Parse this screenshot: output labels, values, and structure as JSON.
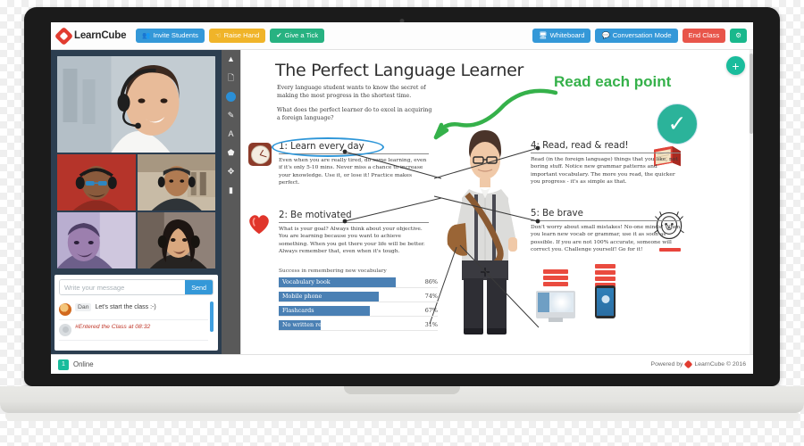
{
  "app": {
    "brand_name": "LearnCube",
    "brand_icon": "cube-logo-icon"
  },
  "toolbar_top": {
    "invite_students": "Invite Students",
    "invite_icon": "users-icon",
    "raise_hand": "Raise Hand",
    "raise_hand_icon": "hand-icon",
    "give_a_tick": "Give a Tick",
    "give_a_tick_icon": "check-icon",
    "whiteboard": "Whiteboard",
    "whiteboard_icon": "monitor-icon",
    "conversation_mode": "Conversation Mode",
    "conversation_icon": "speech-bubble-icon",
    "end_class": "End Class",
    "settings_icon": "gear-icon",
    "colors": {
      "blue": "#3498d8",
      "yellow": "#f0b429",
      "green": "#27b281",
      "red": "#e8554a",
      "teal": "#19b88c"
    }
  },
  "video_panel": {
    "main_tile": "teacher-video-tile",
    "tiles": [
      "student-video-tile-1",
      "student-video-tile-2",
      "student-video-tile-3",
      "student-video-tile-4"
    ]
  },
  "chat": {
    "input_placeholder": "Write your message",
    "input_value": "",
    "send_label": "Send",
    "messages": [
      {
        "author": "Dan",
        "text": "Let's start the class :-)",
        "system": false
      },
      {
        "author": "",
        "text": "#Entered the Class at 08:32",
        "system": true
      }
    ]
  },
  "tools": [
    {
      "name": "collapse-chevron-icon",
      "glyph": "▲"
    },
    {
      "name": "page-icon",
      "glyph": "❑"
    },
    {
      "name": "color-swatch-icon",
      "glyph": ""
    },
    {
      "name": "pencil-icon",
      "glyph": "✎"
    },
    {
      "name": "text-tool-icon",
      "glyph": "A"
    },
    {
      "name": "shape-tool-icon",
      "glyph": "⬟"
    },
    {
      "name": "move-tool-icon",
      "glyph": "✥"
    },
    {
      "name": "eraser-icon",
      "glyph": "▰"
    }
  ],
  "whiteboard": {
    "title": "The Perfect Language Learner",
    "intro_1": "Every language student wants to know the secret of making the most progress in the shortest time.",
    "intro_2": "What does the perfect learner do to excel in acquiring a foreign language?",
    "annotation": "Read each point",
    "annotation_color": "#35b14a",
    "add_button_icon": "plus-icon",
    "check_badge_icon": "check-circle-icon",
    "points": [
      {
        "heading": "1:  Learn every day",
        "body": "Even when you are really tired, do some learning, even if it's only 5-10 mins. Never miss a chance to increase your knowledge. Use it, or lose it! Practice makes perfect.",
        "icon": "clock-icon",
        "highlighted": true
      },
      {
        "heading": "2:  Be motivated",
        "body": "What is your goal? Always think about your objective. You are learning because you want to achieve something. When you get there your life will be better. Always remember that, even when it's tough.",
        "icon": "heart-icon",
        "highlighted": false
      },
      {
        "heading": "4:  Read, read & read!",
        "body": "Read (in the foreign language) things that you like, not boring stuff. Notice new grammar patterns and important vocabulary. The more you read, the quicker you progress - it's as simple as that.",
        "icon": "book-icon",
        "highlighted": false
      },
      {
        "heading": "5:  Be brave",
        "body": "Don't worry about small mistakes! No-one minds! When you learn new vocab or grammar, use it as soon as possible. If you are not 100% accurate, someone will correct you. Challenge yourself! Go for it!",
        "icon": "lion-icon",
        "highlighted": false
      }
    ]
  },
  "chart_data": {
    "type": "bar",
    "title": "Success in remembering new vocabulary",
    "categories": [
      "Vocabulary book",
      "Mobile phone",
      "Flashcards",
      "No written record"
    ],
    "values": [
      86,
      74,
      67,
      31
    ],
    "value_labels": [
      "86%",
      "74%",
      "67%",
      "31%"
    ],
    "xlabel": "",
    "ylabel": "",
    "xlim": [
      0,
      100
    ],
    "orientation": "horizontal",
    "grid": false,
    "legend": false,
    "bar_color": "#4a80b4"
  },
  "statusbar": {
    "online_count": "1",
    "online_label": "Online",
    "powered_by": "Powered by",
    "powered_brand": "LearnCube © 2016"
  }
}
